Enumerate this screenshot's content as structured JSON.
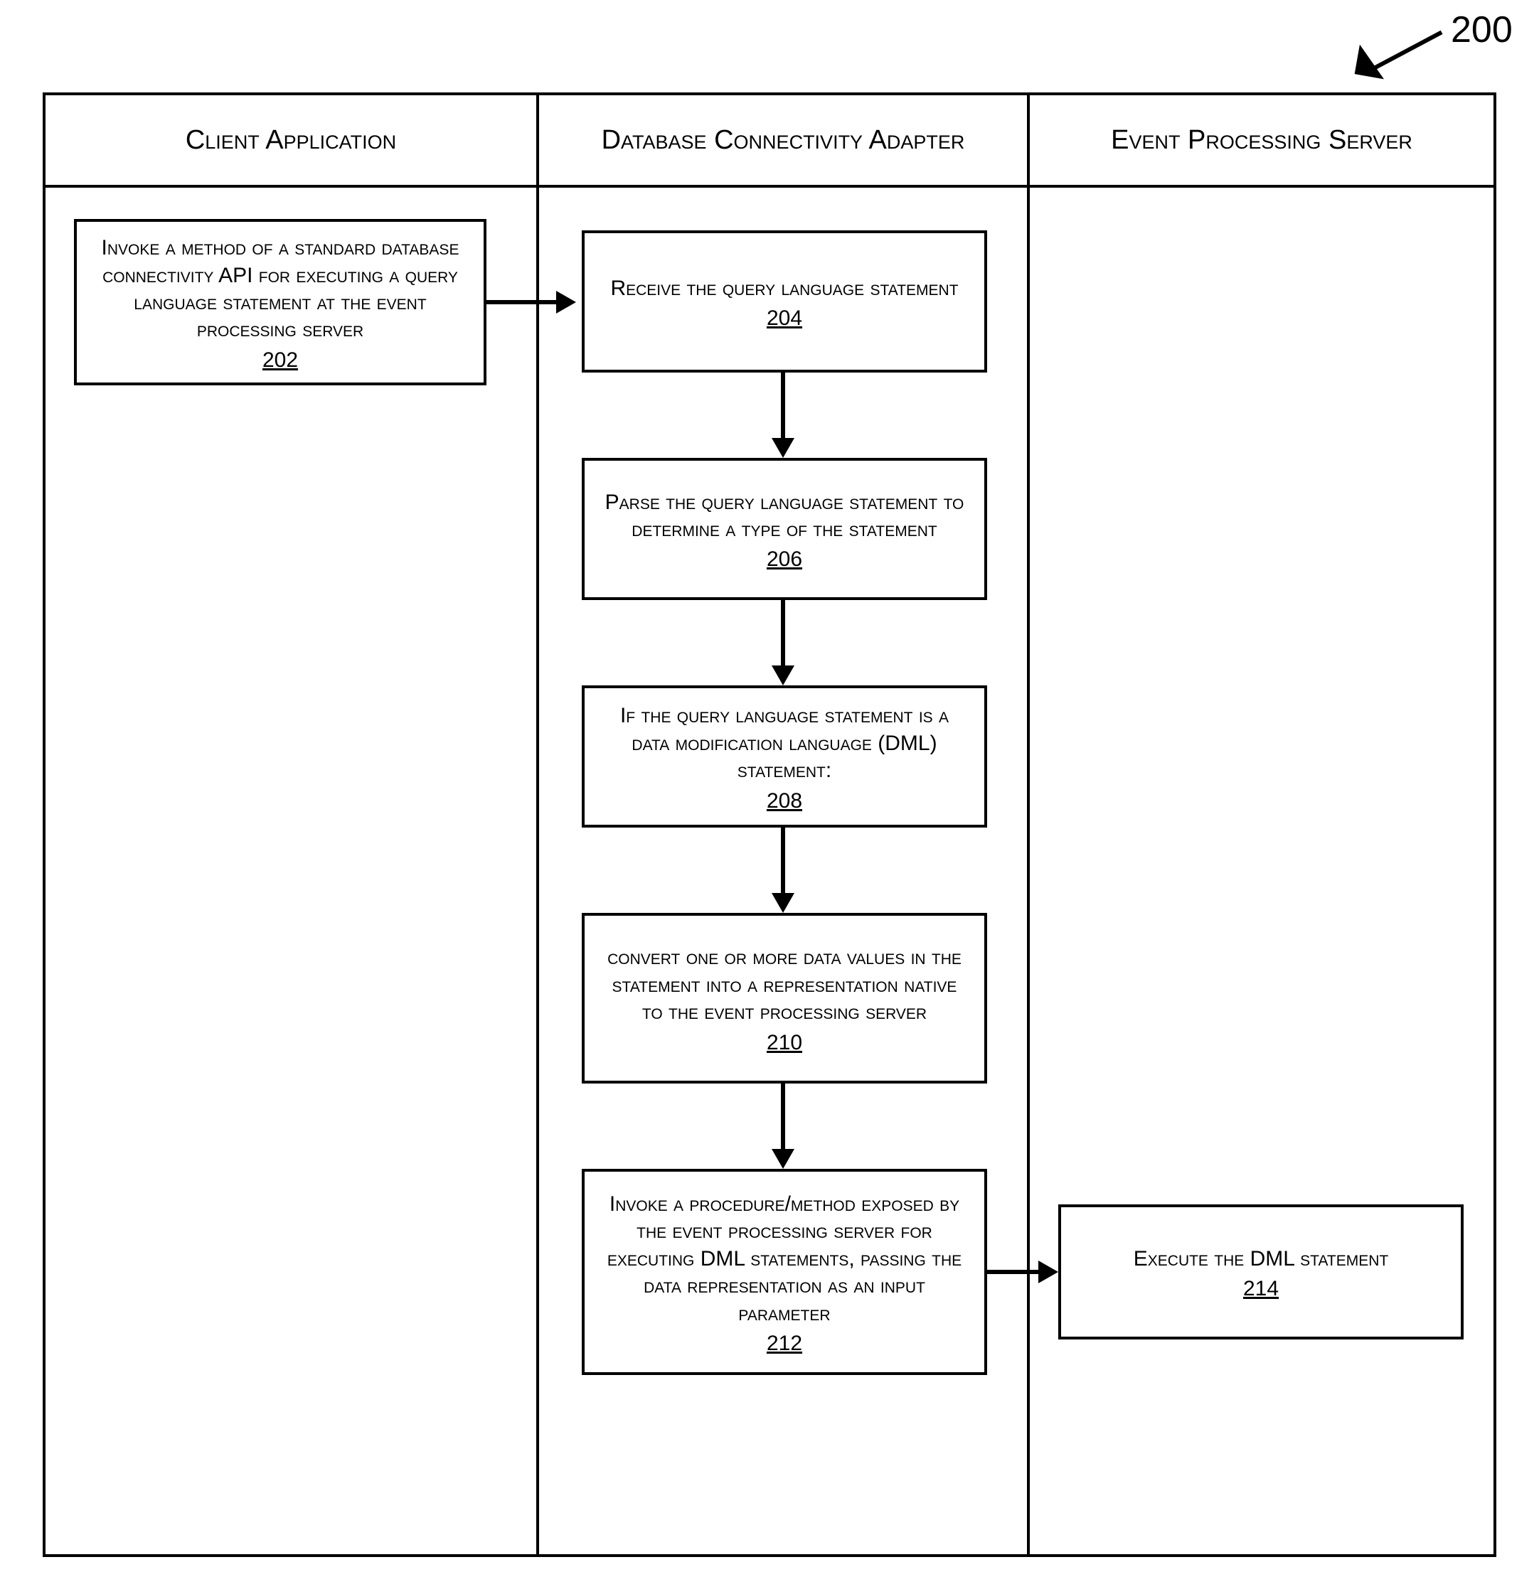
{
  "figure": {
    "label": "200"
  },
  "lanes": {
    "client": "Client Application",
    "adapter": "Database Connectivity Adapter",
    "server": "Event Processing Server"
  },
  "steps": {
    "s202": {
      "text": "Invoke a method of a standard database connectivity API for executing a query language statement at the event processing server",
      "num": "202"
    },
    "s204": {
      "text": "Receive the query language statement",
      "num": "204"
    },
    "s206": {
      "text": "Parse the query language statement to determine a type of the statement",
      "num": "206"
    },
    "s208": {
      "text": "If the query language statement is a data modification language (DML) statement:",
      "num": "208"
    },
    "s210": {
      "text": "convert one or more data values in the statement into a representation native to the event processing server",
      "num": "210"
    },
    "s212": {
      "text": "Invoke a procedure/method exposed by the event processing server for executing DML statements, passing the data representation as an input parameter",
      "num": "212"
    },
    "s214": {
      "text": "Execute the DML statement",
      "num": "214"
    }
  }
}
